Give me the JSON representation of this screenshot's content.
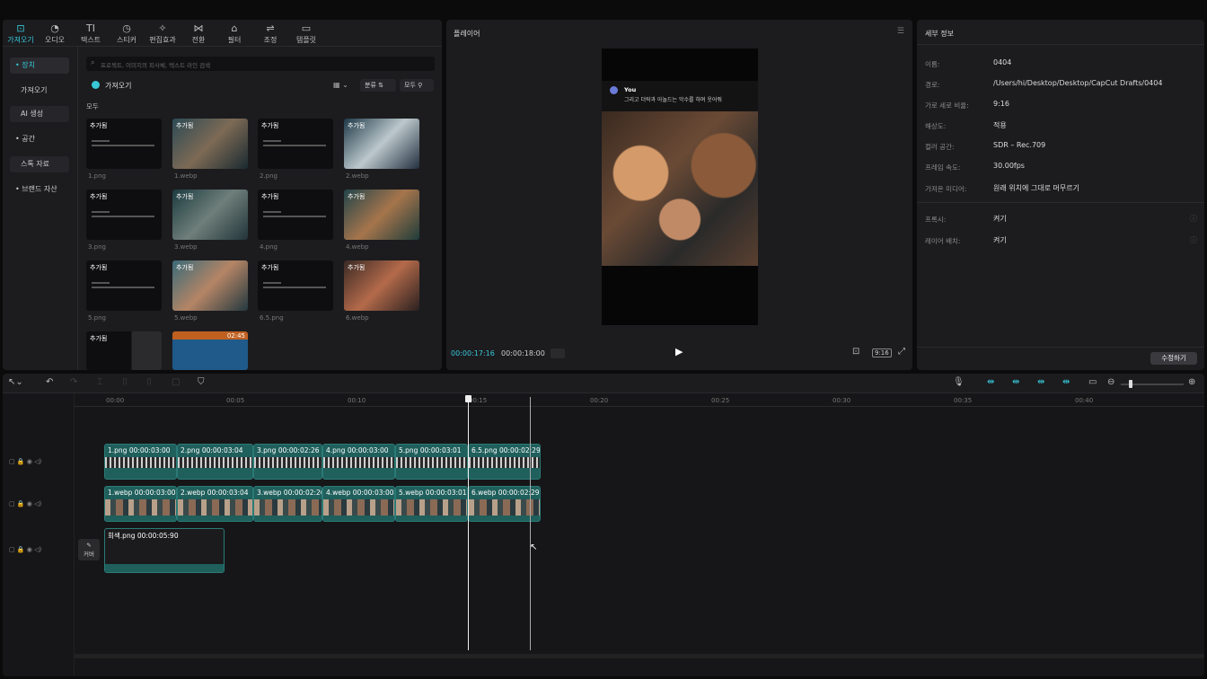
{
  "top_tabs": [
    {
      "label": "가져오기",
      "icon": "import-icon"
    },
    {
      "label": "오디오",
      "icon": "audio-icon"
    },
    {
      "label": "텍스트",
      "icon": "text-icon"
    },
    {
      "label": "스티커",
      "icon": "sticker-icon"
    },
    {
      "label": "편집효과",
      "icon": "effects-icon"
    },
    {
      "label": "전환",
      "icon": "transition-icon"
    },
    {
      "label": "필터",
      "icon": "filter-icon"
    },
    {
      "label": "조정",
      "icon": "adjust-icon"
    },
    {
      "label": "템플릿",
      "icon": "template-icon"
    }
  ],
  "sidebar": {
    "items": [
      "• 장치",
      "가져오기",
      "AI 생성",
      "• 공간",
      "스톡 자료",
      "• 브랜드 자산"
    ]
  },
  "media": {
    "search_placeholder": "프로젝트, 이미지의 피사체, 텍스트 라인 검색",
    "import_label": "가져오기",
    "sort_label": "분류",
    "filter_label": "모두",
    "section_label": "모두",
    "added_tag": "추가됨",
    "items": [
      "1.png",
      "1.webp",
      "2.png",
      "2.webp",
      "3.png",
      "3.webp",
      "4.png",
      "4.webp",
      "5.png",
      "5.webp",
      "6.5.png",
      "6.webp"
    ],
    "last_duration": "02:45"
  },
  "player": {
    "title": "플레이어",
    "chat_user": "You",
    "chat_text": "그리고 더락과 아놀드는 악수를 하며 웃어줘",
    "current_time": "00:00:17:16",
    "total_time": "00:00:18:00",
    "ratio": "9:16"
  },
  "details": {
    "title": "세부 정보",
    "fields": [
      {
        "label": "이름:",
        "value": "0404"
      },
      {
        "label": "경로:",
        "value": "/Users/hi/Desktop/Desktop/CapCut Drafts/0404"
      },
      {
        "label": "가로 세로 비율:",
        "value": "9:16"
      },
      {
        "label": "해상도:",
        "value": "적용"
      },
      {
        "label": "컬러 공간:",
        "value": "SDR – Rec.709"
      },
      {
        "label": "프레임 속도:",
        "value": "30.00fps"
      },
      {
        "label": "가져온 미디어:",
        "value": "원래 위치에 그대로 머무르기"
      }
    ],
    "toggles": [
      {
        "label": "프록시:",
        "value": "켜기"
      },
      {
        "label": "레이어 배치:",
        "value": "켜기"
      }
    ],
    "modify_label": "수정하기"
  },
  "timeline": {
    "ruler": [
      "00:00",
      "00:05",
      "00:10",
      "00:15",
      "00:20",
      "00:25",
      "00:30",
      "00:35",
      "00:40"
    ],
    "track1": [
      {
        "label": "1.png  00:00:03:00"
      },
      {
        "label": "2.png  00:00:03:04"
      },
      {
        "label": "3.png  00:00:02:26"
      },
      {
        "label": "4.png  00:00:03:00"
      },
      {
        "label": "5.png  00:00:03:01"
      },
      {
        "label": "6.5.png  00:00:02:29"
      }
    ],
    "track2": [
      {
        "label": "1.webp  00:00:03:00"
      },
      {
        "label": "2.webp  00:00:03:04"
      },
      {
        "label": "3.webp  00:00:02:26"
      },
      {
        "label": "4.webp  00:00:03:00"
      },
      {
        "label": "5.webp  00:00:03:01"
      },
      {
        "label": "6.webp  00:00:02:29"
      }
    ],
    "track3": {
      "label": "회색.png  00:00:05:90"
    },
    "cover_label": "커버"
  },
  "colors": {
    "accent": "#38c8d8",
    "clip": "#1f5f5c"
  }
}
